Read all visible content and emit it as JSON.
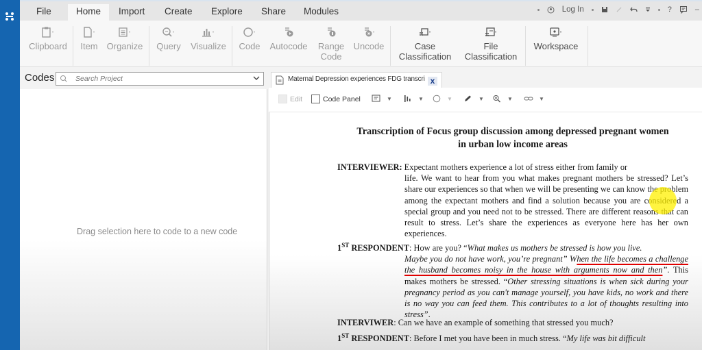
{
  "menu": {
    "tabs": [
      {
        "label": "File",
        "active": false
      },
      {
        "label": "Home",
        "active": true
      },
      {
        "label": "Import",
        "active": false
      },
      {
        "label": "Create",
        "active": false
      },
      {
        "label": "Explore",
        "active": false
      },
      {
        "label": "Share",
        "active": false
      },
      {
        "label": "Modules",
        "active": false
      }
    ],
    "quick_access": {
      "login_label": "Log In",
      "icons": [
        "user-circle-icon",
        "save-icon",
        "edit-icon",
        "undo-icon",
        "customize-icon",
        "help-icon",
        "comment-icon"
      ],
      "help_label": "?"
    }
  },
  "ribbon": {
    "items": [
      {
        "label": "Clipboard",
        "icon": "clipboard-icon",
        "enabled": false
      },
      {
        "label": "Item",
        "icon": "new-item-icon",
        "enabled": false
      },
      {
        "label": "Organize",
        "icon": "organize-icon",
        "enabled": false
      },
      {
        "label": "Query",
        "icon": "query-icon",
        "enabled": false
      },
      {
        "label": "Visualize",
        "icon": "chart-icon",
        "enabled": false
      },
      {
        "label": "Code",
        "icon": "code-circle-icon",
        "enabled": false
      },
      {
        "label": "Autocode",
        "icon": "autocode-icon",
        "enabled": false
      },
      {
        "label": "Range Code",
        "icon": "range-code-icon",
        "enabled": false
      },
      {
        "label": "Uncode",
        "icon": "uncode-icon",
        "enabled": false
      },
      {
        "label": "Case Classification",
        "icon": "case-classification-icon",
        "enabled": true
      },
      {
        "label": "File Classification",
        "icon": "file-classification-icon",
        "enabled": true
      },
      {
        "label": "Workspace",
        "icon": "workspace-icon",
        "enabled": true
      }
    ]
  },
  "codes_pane": {
    "title": "Codes",
    "search_placeholder": "Search Project",
    "drop_hint": "Drag selection here to code to a new code"
  },
  "document": {
    "tab_label": "Maternal Depression experiences FDG transcri",
    "close_label": "x",
    "toolbar": {
      "edit_label": "Edit",
      "edit_checked": false,
      "code_panel_label": "Code Panel",
      "code_panel_checked": false
    },
    "title_line1": "Transcription of Focus group discussion among depressed pregnant women",
    "title_line2": "in urban low income areas",
    "paragraphs": {
      "p1": {
        "speaker": "INTERVIEWER:",
        "first": " Expectant mothers experience a lot of stress either from family or",
        "rest": "life. We want to hear from you what makes pregnant mothers be stressed? Let’s share our experiences so that when we will be presenting we can know the problem among the expectant mothers and find a solution because you are considered a special group and you need not to be stressed. There are different reasons that can result to stress. Let’s share the experiences as everyone here has her own experiences."
      },
      "p2": {
        "speaker_num": "1",
        "speaker_sup": "ST",
        "speaker": " RESPONDENT",
        "first_plain": ": How are you? “",
        "first_ital": "What makes us mothers be stressed is how you live.",
        "ital_a": "Maybe you do not have work, you’re pregnant” W",
        "underlined": "hen the life becomes a challenge the husband becomes noisy in the house with arguments now and then",
        "ital_b": "”",
        "plain_c": ". This makes mothers be stressed. “",
        "ital_d": "Other stressing situations is when sick during your pregnancy period as you can't manage yourself, you have kids, no work and there is no way you can feed them. This contributes to a lot of thoughts resulting into stress”",
        "plain_e": "."
      },
      "p3": {
        "speaker": "INTERVIWER",
        "text": ": Can we have an example of something that stressed you much?"
      },
      "p4": {
        "speaker_num": "1",
        "speaker_sup": "ST",
        "speaker": " RESPONDENT",
        "plain": ": Before I met you have been in much stress. “",
        "ital": "My life was bit difficult"
      }
    }
  },
  "colors": {
    "rail": "#1565b0",
    "underline_annotation": "#e00000",
    "cursor_highlight": "#fff000",
    "tab_close": "#1b3f8b"
  }
}
